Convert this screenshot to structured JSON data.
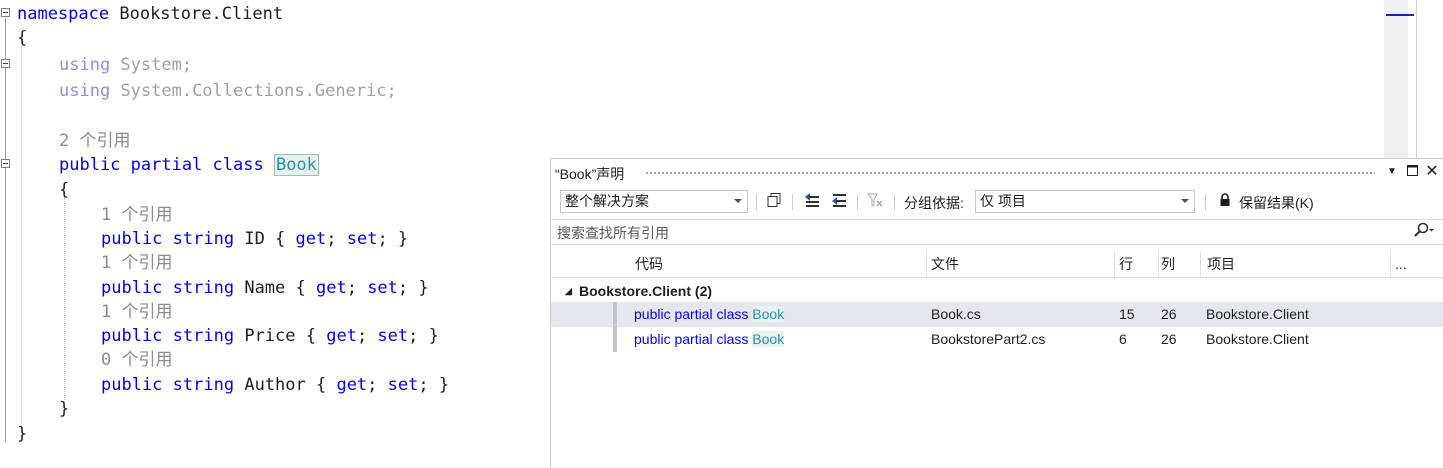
{
  "editor": {
    "lines": {
      "l1": {
        "kw": "namespace",
        "rest": " Bookstore.Client"
      },
      "l2": "{",
      "l3": {
        "kw": "using",
        "ns": " System;"
      },
      "l4": {
        "kw": "using",
        "ns": " System.Collections.Generic;"
      },
      "l5": "2 个引用",
      "l6": {
        "kw": "public partial class",
        "name": "Book"
      },
      "l7": "{",
      "l8": "1 个引用",
      "l9": {
        "kw1": "public",
        "kw2": "string",
        "prop": " ID { ",
        "get": "get",
        "mid": "; ",
        "set": "set",
        "end": "; }"
      },
      "l10": "1 个引用",
      "l11": {
        "kw1": "public",
        "kw2": "string",
        "prop": " Name { ",
        "get": "get",
        "mid": "; ",
        "set": "set",
        "end": "; }"
      },
      "l12": "1 个引用",
      "l13": {
        "kw1": "public",
        "kw2": "string",
        "prop": " Price { ",
        "get": "get",
        "mid": "; ",
        "set": "set",
        "end": "; }"
      },
      "l14": "0 个引用",
      "l15": {
        "kw1": "public",
        "kw2": "string",
        "prop": " Author { ",
        "get": "get",
        "mid": "; ",
        "set": "set",
        "end": "; }"
      },
      "l16": "}",
      "l17": "}"
    },
    "colors": {
      "keyword": "#0000ff",
      "class": "#2b91af",
      "reference_hint": "#8a8a8a"
    }
  },
  "panel": {
    "title": "“Book”声明",
    "scope_value": "整个解决方案",
    "group_by_label": "分组依据:",
    "group_by_value": "仅 项目",
    "keep_results": "保留结果(K)",
    "search_placeholder": "搜索查找所有引用",
    "columns": {
      "code": "代码",
      "file": "文件",
      "line": "行",
      "col": "列",
      "project": "项目",
      "more": "..."
    },
    "group": {
      "name": "Bookstore.Client",
      "count": "(2)"
    },
    "results": [
      {
        "code_kw": "public partial class",
        "code_name": "Book",
        "file": "Book.cs",
        "line": "15",
        "col": "26",
        "project": "Bookstore.Client"
      },
      {
        "code_kw": "public partial class",
        "code_name": "Book",
        "file": "BookstorePart2.cs",
        "line": "6",
        "col": "26",
        "project": "Bookstore.Client"
      }
    ],
    "icons": [
      "chevron-down-icon",
      "maximize-icon",
      "close-icon",
      "copy-icon",
      "previous-location-icon",
      "next-location-icon",
      "clear-filter-icon",
      "lock-icon",
      "search-icon"
    ]
  }
}
